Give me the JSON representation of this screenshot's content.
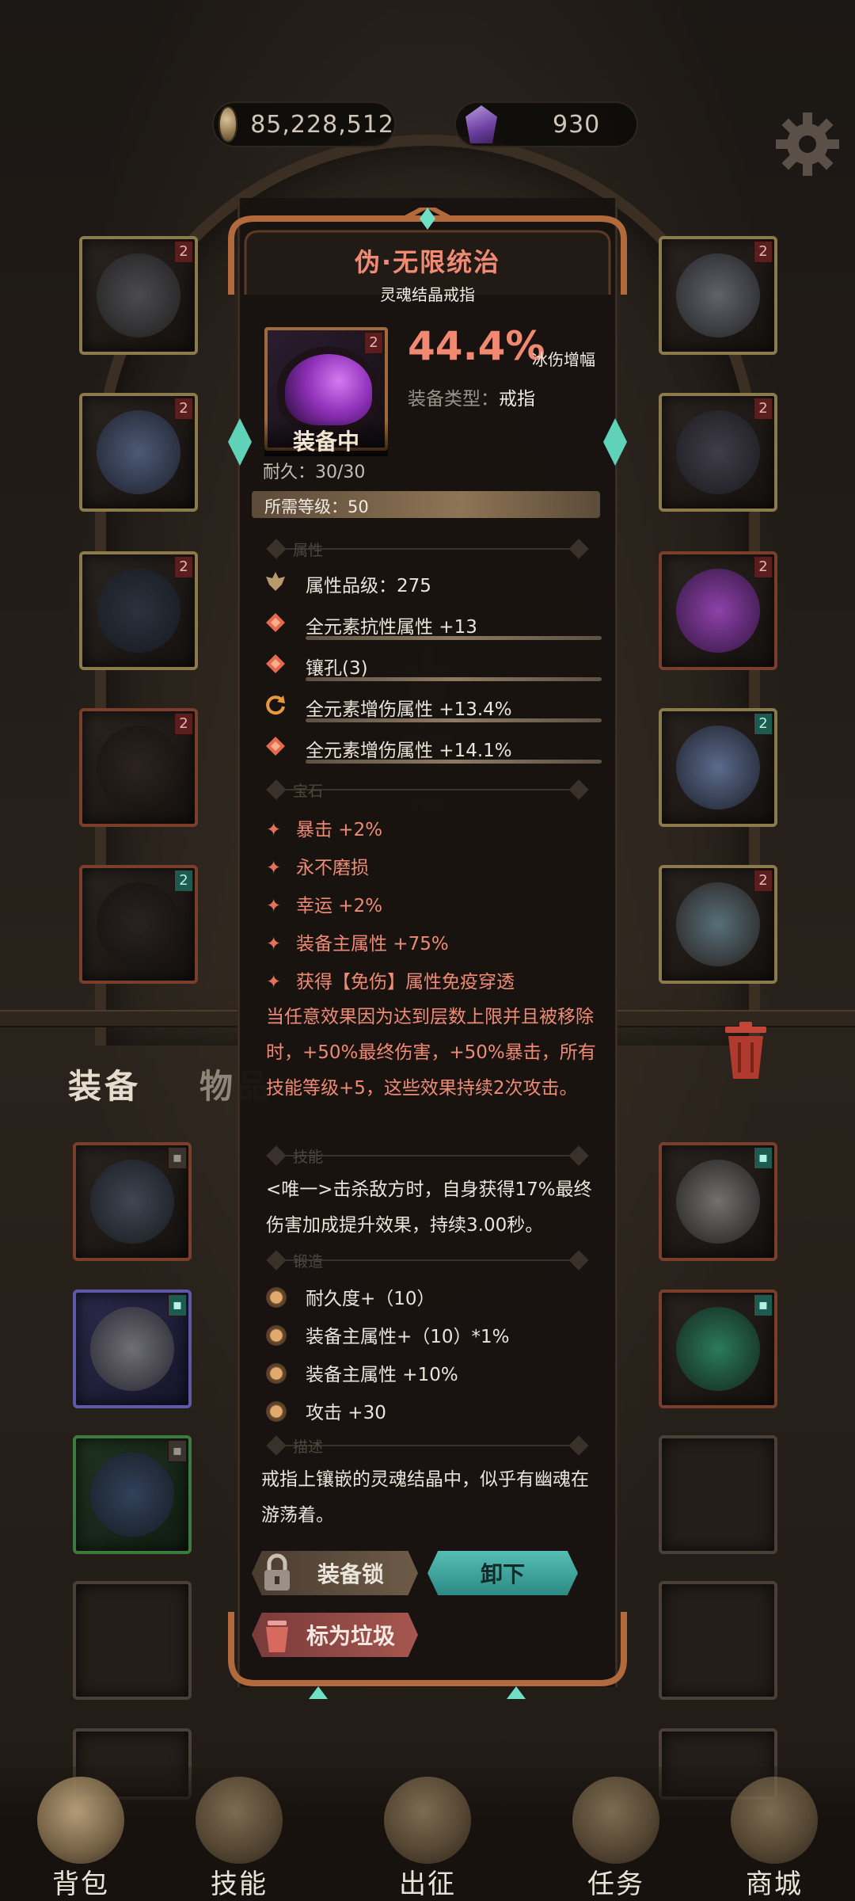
{
  "currency": {
    "gold": "85,228,512",
    "gems": "930",
    "gold_icon": "coin-icon",
    "gem_icon": "purple-gem-icon",
    "settings_icon": "gear-icon"
  },
  "equipment_slots": {
    "left": [
      {
        "badge": "2"
      },
      {
        "badge": "2"
      },
      {
        "badge": "2"
      },
      {
        "badge": "2"
      },
      {
        "badge": "2"
      }
    ],
    "right": [
      {
        "badge": "2"
      },
      {
        "badge": "2"
      },
      {
        "badge": "2"
      },
      {
        "badge": "2"
      },
      {
        "badge": "2"
      }
    ]
  },
  "inventory": {
    "tab_equipment": "装备",
    "tab_items": "物品",
    "trash_icon": "trash-icon"
  },
  "popup": {
    "name": "伪·无限统治",
    "subtitle": "灵魂结晶戒指",
    "item_badge": "2",
    "equipped_label": "装备中",
    "main_stat_value": "44.4%",
    "main_stat_name": "冰伤增幅",
    "type_label": "装备类型：",
    "type_value": "戒指",
    "durability": "耐久：30/30",
    "required_level": "所需等级：50",
    "section_attributes": "属性",
    "attributes": [
      {
        "text": "属性品级：275",
        "icon": "quality-crest-icon"
      },
      {
        "text": "全元素抗性属性 +13",
        "icon": "orange-diamond-icon"
      },
      {
        "text": "镶孔(3)",
        "icon": "orange-diamond-icon"
      },
      {
        "text": "全元素增伤属性 +13.4%",
        "icon": "refresh-icon"
      },
      {
        "text": "全元素增伤属性 +14.1%",
        "icon": "orange-diamond-icon"
      }
    ],
    "section_gems": "宝石",
    "gems": [
      "暴击 +2%",
      "永不磨损",
      "幸运 +2%",
      "装备主属性 +75%",
      "获得【免伤】属性免疫穿透"
    ],
    "gem_effect": "当任意效果因为达到层数上限并且被移除时，+50%最终伤害，+50%暴击，所有技能等级+5，这些效果持续2次攻击。",
    "section_skill": "技能",
    "skill_text": "<唯一>击杀敌方时，自身获得17%最终伤害加成提升效果，持续3.00秒。",
    "section_forge": "锻造",
    "forge": [
      "耐久度+（10）",
      "装备主属性+（10）*1%",
      "装备主属性 +10%",
      "攻击 +30"
    ],
    "section_desc": "描述",
    "description": "戒指上镶嵌的灵魂结晶中，似乎有幽魂在游荡着。",
    "btn_lock": "装备锁",
    "btn_unequip": "卸下",
    "btn_junk": "标为垃圾"
  },
  "nav": [
    {
      "label": "背包",
      "icon": "backpack-icon"
    },
    {
      "label": "技能",
      "icon": "skill-book-icon"
    },
    {
      "label": "出征",
      "icon": "battle-sword-icon"
    },
    {
      "label": "任务",
      "icon": "quest-scroll-icon"
    },
    {
      "label": "商城",
      "icon": "shop-crown-icon"
    }
  ],
  "colors": {
    "rarity_red": "#ef8a74",
    "teal_button": "#56bdb5",
    "panel_bg": "#181310"
  }
}
